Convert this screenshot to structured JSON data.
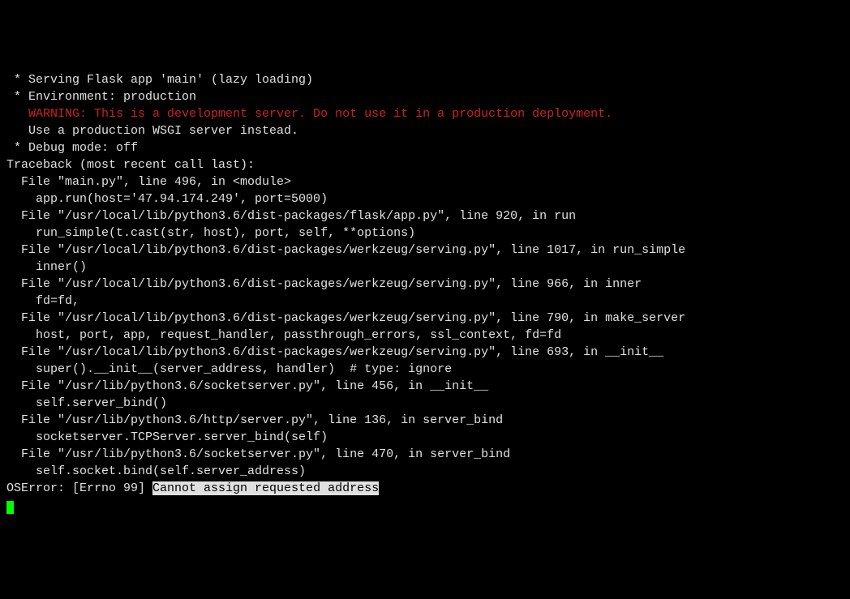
{
  "terminal": {
    "lines": [
      {
        "text": " * Serving Flask app 'main' (lazy loading)",
        "class": ""
      },
      {
        "text": " * Environment: production",
        "class": ""
      },
      {
        "text": "   WARNING: This is a development server. Do not use it in a production deployment.",
        "class": "warning"
      },
      {
        "text": "   Use a production WSGI server instead.",
        "class": ""
      },
      {
        "text": " * Debug mode: off",
        "class": ""
      },
      {
        "text": "Traceback (most recent call last):",
        "class": ""
      },
      {
        "text": "  File \"main.py\", line 496, in <module>",
        "class": ""
      },
      {
        "text": "    app.run(host='47.94.174.249', port=5000)",
        "class": ""
      },
      {
        "text": "  File \"/usr/local/lib/python3.6/dist-packages/flask/app.py\", line 920, in run",
        "class": ""
      },
      {
        "text": "    run_simple(t.cast(str, host), port, self, **options)",
        "class": ""
      },
      {
        "text": "  File \"/usr/local/lib/python3.6/dist-packages/werkzeug/serving.py\", line 1017, in run_simple",
        "class": ""
      },
      {
        "text": "    inner()",
        "class": ""
      },
      {
        "text": "  File \"/usr/local/lib/python3.6/dist-packages/werkzeug/serving.py\", line 966, in inner",
        "class": ""
      },
      {
        "text": "    fd=fd,",
        "class": ""
      },
      {
        "text": "  File \"/usr/local/lib/python3.6/dist-packages/werkzeug/serving.py\", line 790, in make_server",
        "class": ""
      },
      {
        "text": "    host, port, app, request_handler, passthrough_errors, ssl_context, fd=fd",
        "class": ""
      },
      {
        "text": "  File \"/usr/local/lib/python3.6/dist-packages/werkzeug/serving.py\", line 693, in __init__",
        "class": ""
      },
      {
        "text": "    super().__init__(server_address, handler)  # type: ignore",
        "class": ""
      },
      {
        "text": "  File \"/usr/lib/python3.6/socketserver.py\", line 456, in __init__",
        "class": ""
      },
      {
        "text": "    self.server_bind()",
        "class": ""
      },
      {
        "text": "  File \"/usr/lib/python3.6/http/server.py\", line 136, in server_bind",
        "class": ""
      },
      {
        "text": "    socketserver.TCPServer.server_bind(self)",
        "class": ""
      },
      {
        "text": "  File \"/usr/lib/python3.6/socketserver.py\", line 470, in server_bind",
        "class": ""
      },
      {
        "text": "    self.socket.bind(self.server_address)",
        "class": ""
      }
    ],
    "error_prefix": "OSError: [Errno 99] ",
    "error_highlight": "Cannot assign requested address"
  }
}
